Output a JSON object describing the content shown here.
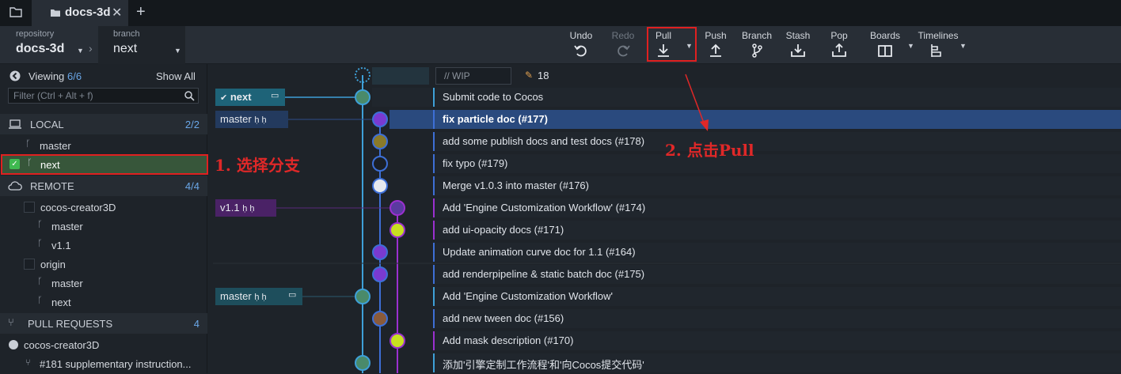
{
  "tab": {
    "title": "docs-3d",
    "close": "✕",
    "plus": "+"
  },
  "repo": {
    "label": "repository",
    "name": "docs-3d"
  },
  "branch": {
    "label": "branch",
    "name": "next"
  },
  "toolbar": {
    "undo": "Undo",
    "redo": "Redo",
    "pull": "Pull",
    "push": "Push",
    "branch": "Branch",
    "stash": "Stash",
    "pop": "Pop",
    "boards": "Boards",
    "timelines": "Timelines"
  },
  "sidebar": {
    "viewing_label": "Viewing",
    "viewing_count": "6/6",
    "show_all": "Show All",
    "filter_placeholder": "Filter (Ctrl + Alt + f)",
    "local": {
      "label": "LOCAL",
      "count": "2/2",
      "branches": [
        "master",
        "next"
      ]
    },
    "remote": {
      "label": "REMOTE",
      "count": "4/4",
      "remotes": [
        {
          "name": "cocos-creator3D",
          "branches": [
            "master",
            "v1.1"
          ]
        },
        {
          "name": "origin",
          "branches": [
            "master",
            "next"
          ]
        }
      ]
    },
    "pull_requests": {
      "label": "PULL REQUESTS",
      "count": "4",
      "repo": "cocos-creator3D",
      "item": "#181 supplementary instruction..."
    }
  },
  "graph": {
    "wip_placeholder": "// WIP",
    "wip_count": "18",
    "commits": [
      {
        "ref": "next",
        "msg": "Submit code to Cocos"
      },
      {
        "ref": "master",
        "msg": "fix particle doc (#177)"
      },
      {
        "ref": "",
        "msg": "add some publish docs and test docs (#178)"
      },
      {
        "ref": "",
        "msg": "fix typo (#179)"
      },
      {
        "ref": "",
        "msg": "Merge v1.0.3 into master (#176)"
      },
      {
        "ref": "v1.1",
        "msg": "Add 'Engine Customization Workflow' (#174)"
      },
      {
        "ref": "",
        "msg": "add ui-opacity docs (#171)"
      },
      {
        "ref": "",
        "msg": "Update animation curve doc for 1.1 (#164)"
      },
      {
        "ref": "",
        "msg": "add renderpipeline & static batch doc (#175)"
      },
      {
        "ref": "master",
        "msg": "Add 'Engine Customization Workflow'"
      },
      {
        "ref": "",
        "msg": "add new tween doc (#156)"
      },
      {
        "ref": "",
        "msg": "Add mask description (#170)"
      },
      {
        "ref": "",
        "msg": "添加'引擎定制工作流程'和'向Cocos提交代码'"
      }
    ]
  },
  "annotations": {
    "step1": "1. 选择分支",
    "step2": "2. 点击Pull"
  },
  "colors": {
    "accent": "#3ea0d8",
    "highlight": "#e02020",
    "purple": "#9b30d0",
    "blue": "#3d6fd6"
  }
}
